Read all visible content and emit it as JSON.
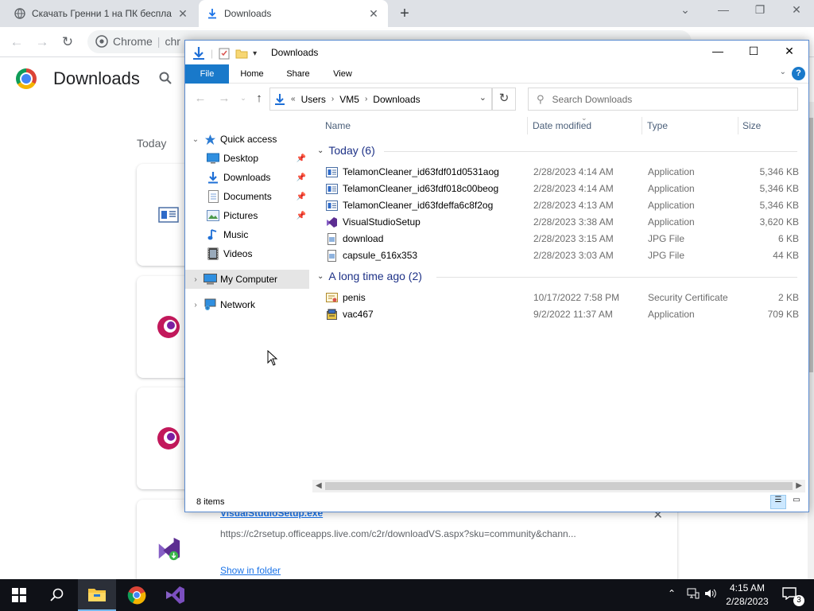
{
  "browser": {
    "tabs": [
      {
        "title": "Скачать Гренни 1 на ПК беспла",
        "active": false
      },
      {
        "title": "Downloads",
        "active": true
      }
    ],
    "omnibox_chip": "Chrome",
    "omnibox_text": "chr",
    "page_title": "Downloads",
    "section_today": "Today",
    "card": {
      "file_name": "VisualStudioSetup.exe",
      "url": "https://c2rsetup.officeapps.live.com/c2r/downloadVS.aspx?sku=community&chann...",
      "show_in_folder": "Show in folder"
    }
  },
  "explorer": {
    "title": "Downloads",
    "ribbon_tabs": [
      "File",
      "Home",
      "Share",
      "View"
    ],
    "help": "?",
    "breadcrumb": [
      "Users",
      "VM5",
      "Downloads"
    ],
    "breadcrumb_overflow": "«",
    "search_placeholder": "Search Downloads",
    "nav": {
      "quick_access": "Quick access",
      "items": [
        "Desktop",
        "Downloads",
        "Documents",
        "Pictures",
        "Music",
        "Videos"
      ],
      "my_computer": "My Computer",
      "network": "Network"
    },
    "columns": {
      "name": "Name",
      "date": "Date modified",
      "type": "Type",
      "size": "Size"
    },
    "groups": [
      {
        "label": "Today (6)",
        "files": [
          {
            "name": "TelamonCleaner_id63fdf01d0531aog",
            "date": "2/28/2023 4:14 AM",
            "type": "Application",
            "size": "5,346 KB",
            "icon": "app-icon"
          },
          {
            "name": "TelamonCleaner_id63fdf018c00beog",
            "date": "2/28/2023 4:14 AM",
            "type": "Application",
            "size": "5,346 KB",
            "icon": "app-icon"
          },
          {
            "name": "TelamonCleaner_id63fdeffa6c8f2og",
            "date": "2/28/2023 4:13 AM",
            "type": "Application",
            "size": "5,346 KB",
            "icon": "app-icon"
          },
          {
            "name": "VisualStudioSetup",
            "date": "2/28/2023 3:38 AM",
            "type": "Application",
            "size": "3,620 KB",
            "icon": "visual-studio-icon"
          },
          {
            "name": "download",
            "date": "2/28/2023 3:15 AM",
            "type": "JPG File",
            "size": "6 KB",
            "icon": "image-file-icon"
          },
          {
            "name": "capsule_616x353",
            "date": "2/28/2023 3:03 AM",
            "type": "JPG File",
            "size": "44 KB",
            "icon": "image-file-icon"
          }
        ]
      },
      {
        "label": "A long time ago (2)",
        "files": [
          {
            "name": "penis",
            "date": "10/17/2022 7:58 PM",
            "type": "Security Certificate",
            "size": "2 KB",
            "icon": "certificate-icon"
          },
          {
            "name": "vac467",
            "date": "9/2/2022 11:37 AM",
            "type": "Application",
            "size": "709 KB",
            "icon": "installer-icon"
          }
        ]
      }
    ],
    "status_count": "8 items"
  },
  "taskbar": {
    "time": "4:15 AM",
    "date": "2/28/2023",
    "notification_count": "3"
  }
}
